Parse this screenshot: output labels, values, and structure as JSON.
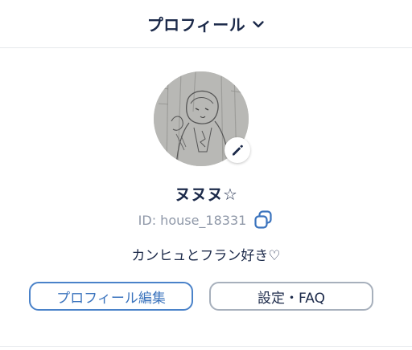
{
  "header": {
    "title": "プロフィール",
    "dropdown_icon": "chevron-down-icon"
  },
  "profile": {
    "avatar_icon": "user-avatar-drawing",
    "edit_icon": "pencil-icon",
    "username": "ヌヌヌ☆",
    "id_text": "ID: house_18331",
    "copy_icon": "copy-icon",
    "bio": "カンヒュとフラン好き♡"
  },
  "actions": {
    "edit_profile_label": "プロフィール編集",
    "settings_label": "設定・FAQ"
  },
  "colors": {
    "title": "#1c2a4a",
    "accent_blue": "#4a82c9",
    "muted_text": "#8f98a8",
    "border_gray": "#a7b0bc"
  }
}
